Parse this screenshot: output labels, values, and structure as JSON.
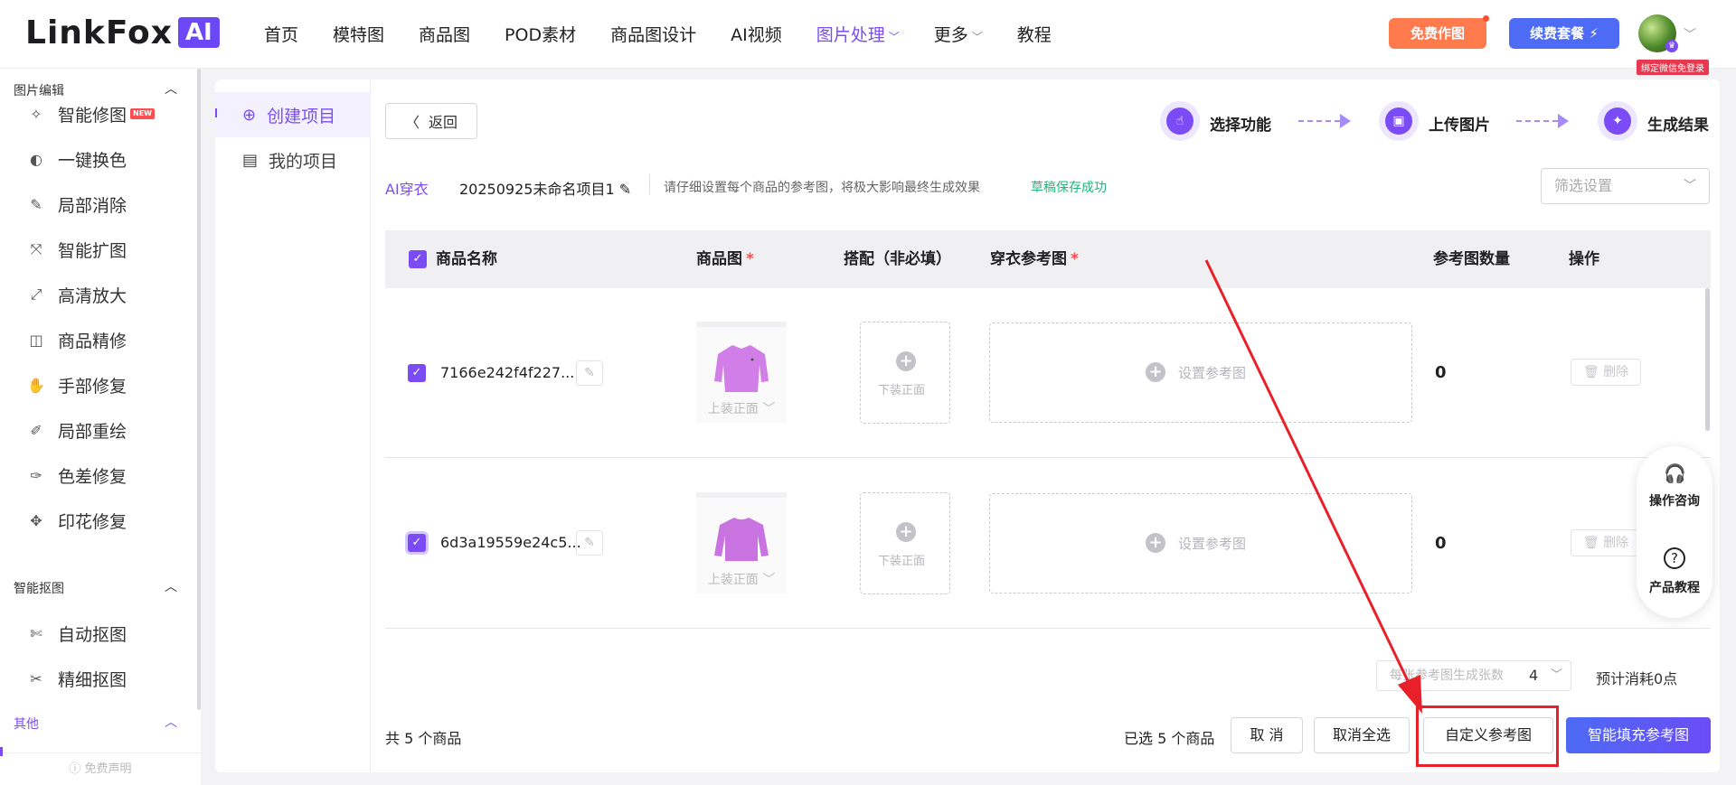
{
  "brand": {
    "logo_text": "LinkFox",
    "logo_badge": "AI"
  },
  "nav": {
    "items": [
      {
        "label": "首页"
      },
      {
        "label": "模特图"
      },
      {
        "label": "商品图"
      },
      {
        "label": "POD素材"
      },
      {
        "label": "商品图设计"
      },
      {
        "label": "AI视频"
      },
      {
        "label": "图片处理",
        "active": true
      },
      {
        "label": "更多"
      },
      {
        "label": "教程"
      }
    ],
    "free_btn": "免费作图",
    "renew_btn": "续费套餐 ⚡",
    "wx_tag": "绑定微信免登录"
  },
  "sidebar": {
    "sections": [
      {
        "title": "图片编辑",
        "items": [
          {
            "label": "智能修图",
            "badge": "NEW",
            "icon": "magic-wand-icon"
          },
          {
            "label": "一键换色",
            "icon": "palette-icon"
          },
          {
            "label": "局部消除",
            "icon": "eraser-icon"
          },
          {
            "label": "智能扩图",
            "icon": "expand-icon"
          },
          {
            "label": "高清放大",
            "icon": "upscale-icon"
          },
          {
            "label": "商品精修",
            "icon": "retouch-icon"
          },
          {
            "label": "手部修复",
            "icon": "hand-icon"
          },
          {
            "label": "局部重绘",
            "icon": "redraw-icon"
          },
          {
            "label": "色差修复",
            "icon": "dropper-icon"
          },
          {
            "label": "印花修复",
            "icon": "pattern-icon"
          }
        ]
      },
      {
        "title": "智能抠图",
        "items": [
          {
            "label": "自动抠图",
            "icon": "auto-cutout-icon"
          },
          {
            "label": "精细抠图",
            "icon": "fine-cutout-icon"
          }
        ]
      },
      {
        "title": "其他",
        "items": []
      }
    ],
    "footer": "ⓘ 免费声明"
  },
  "projects": {
    "create": "创建项目",
    "mine": "我的项目"
  },
  "header": {
    "back": "返回",
    "steps": [
      "选择功能",
      "上传图片",
      "生成结果"
    ],
    "tool": "AI穿衣",
    "project_name": "20250925未命名项目1",
    "hint": "请仔细设置每个商品的参考图，将极大影响最终生成效果",
    "draft_status": "草稿保存成功",
    "filter_placeholder": "筛选设置"
  },
  "table": {
    "headers": {
      "name": "商品名称",
      "product_img": "商品图",
      "match": "搭配（非必填）",
      "ref": "穿衣参考图",
      "ref_count": "参考图数量",
      "ops": "操作"
    },
    "required_mark": "*",
    "rows": [
      {
        "name": "7166e242f4f227...",
        "thumb_label": "上装正面",
        "match_label": "下装正面",
        "ref_label": "设置参考图",
        "ref_count": "0",
        "delete": "删除"
      },
      {
        "name": "6d3a19559e24c5...",
        "thumb_label": "上装正面",
        "match_label": "下装正面",
        "ref_label": "设置参考图",
        "ref_count": "0",
        "delete": "删除"
      }
    ]
  },
  "float": {
    "consult": "操作咨询",
    "tutorial": "产品教程"
  },
  "footer": {
    "gen_label": "每张参考图生成张数",
    "gen_value": "4",
    "estimate": "预计消耗0点",
    "total": "共 5 个商品",
    "selected": "已选 5 个商品",
    "cancel": "取 消",
    "deselect_all": "取消全选",
    "custom_ref": "自定义参考图",
    "smart_fill": "智能填充参考图"
  },
  "colors": {
    "accent": "#7b4cf6",
    "primary_btn": "#4d6bf5",
    "free_btn": "#ff7a4d",
    "draft_status": "#21b57a",
    "annotation": "#e8202a"
  }
}
